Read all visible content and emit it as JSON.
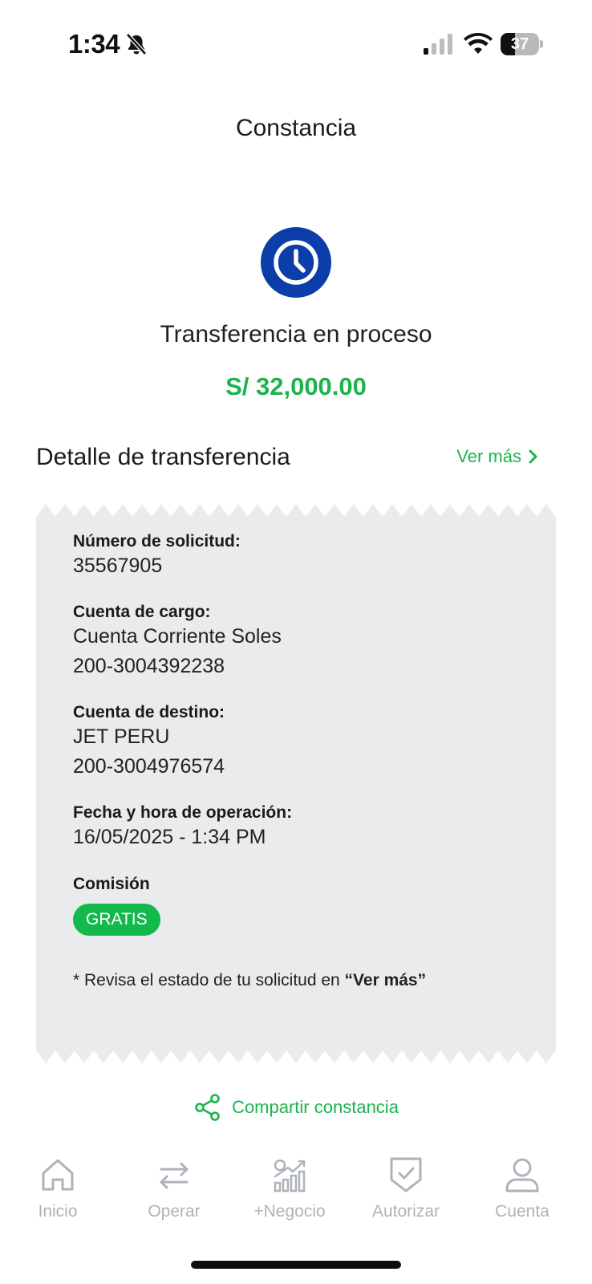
{
  "status_bar": {
    "time": "1:34",
    "battery_level": "37",
    "battery_fill_fraction": 0.37,
    "icons": [
      "bell-slash-icon",
      "signal-icon",
      "wifi-icon",
      "battery-icon"
    ]
  },
  "header": {
    "title": "Constancia"
  },
  "result": {
    "icon": "clock-icon",
    "icon_color": "#0b3ea8",
    "status_text": "Transferencia en proceso",
    "amount": "S/ 32,000.00",
    "amount_color": "#1bb34d"
  },
  "detail": {
    "title": "Detalle de transferencia",
    "ver_mas_label": "Ver más",
    "request_number_label": "Número de solicitud:",
    "request_number": "35567905",
    "source_account_label": "Cuenta de cargo:",
    "source_account_name": "Cuenta Corriente Soles",
    "source_account_number": "200-3004392238",
    "destination_account_label": "Cuenta de destino:",
    "destination_account_name": "JET PERU",
    "destination_account_number": "200-3004976574",
    "datetime_label": "Fecha y hora de operación:",
    "datetime_value": "16/05/2025 - 1:34 PM",
    "commission_label": "Comisión",
    "commission_value": "GRATIS",
    "note_prefix": "* Revisa el estado de tu solicitud en ",
    "note_link": "“Ver más”"
  },
  "share": {
    "label": "Compartir constancia",
    "icon": "share-icon"
  },
  "bottom_nav": {
    "items": [
      {
        "label": "Inicio",
        "icon": "home-icon"
      },
      {
        "label": "Operar",
        "icon": "transfer-arrows-icon"
      },
      {
        "label": "+Negocio",
        "icon": "business-chart-icon"
      },
      {
        "label": "Autorizar",
        "icon": "shield-check-icon"
      },
      {
        "label": "Cuenta",
        "icon": "user-icon"
      }
    ]
  },
  "colors": {
    "accent": "#1bb34d",
    "primary_blue": "#0b3ea8",
    "card_bg": "#eaebec",
    "nav_inactive": "#aeb3b9"
  }
}
